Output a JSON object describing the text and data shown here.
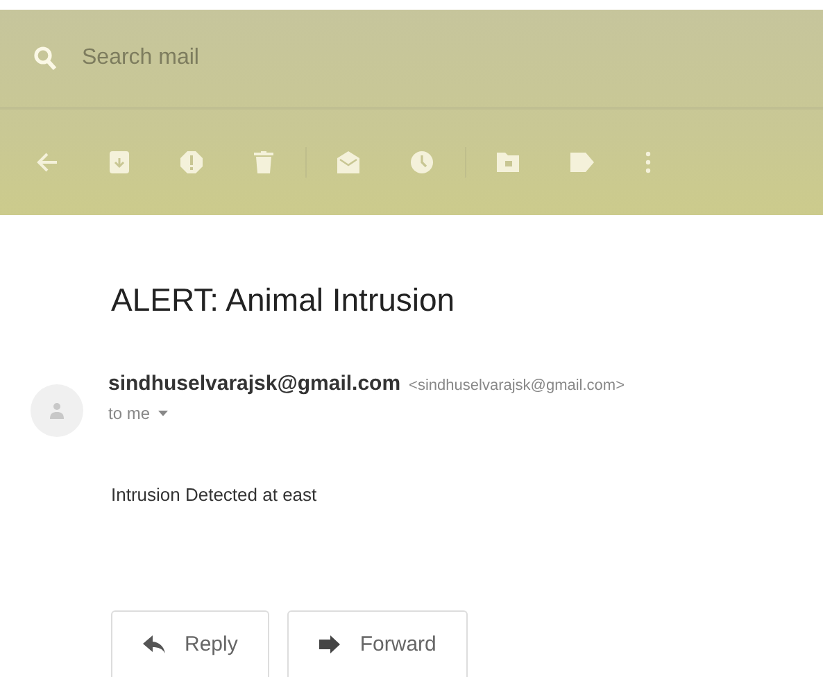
{
  "search": {
    "placeholder": "Search mail"
  },
  "toolbar": {
    "actions": [
      {
        "kind": "back"
      },
      {
        "kind": "archive"
      },
      {
        "kind": "report"
      },
      {
        "kind": "delete"
      },
      {
        "kind": "divider"
      },
      {
        "kind": "unread"
      },
      {
        "kind": "snooze"
      },
      {
        "kind": "divider"
      },
      {
        "kind": "move"
      },
      {
        "kind": "label"
      },
      {
        "kind": "more"
      }
    ]
  },
  "message": {
    "subject": "ALERT: Animal Intrusion",
    "sender_name": "sindhuselvarajsk@gmail.com",
    "sender_email": "<sindhuselvarajsk@gmail.com>",
    "recipient": "to me",
    "body": "Intrusion Detected at east"
  },
  "buttons": [
    {
      "kind": "reply",
      "label": "Reply"
    },
    {
      "kind": "forward",
      "label": "Forward"
    }
  ]
}
